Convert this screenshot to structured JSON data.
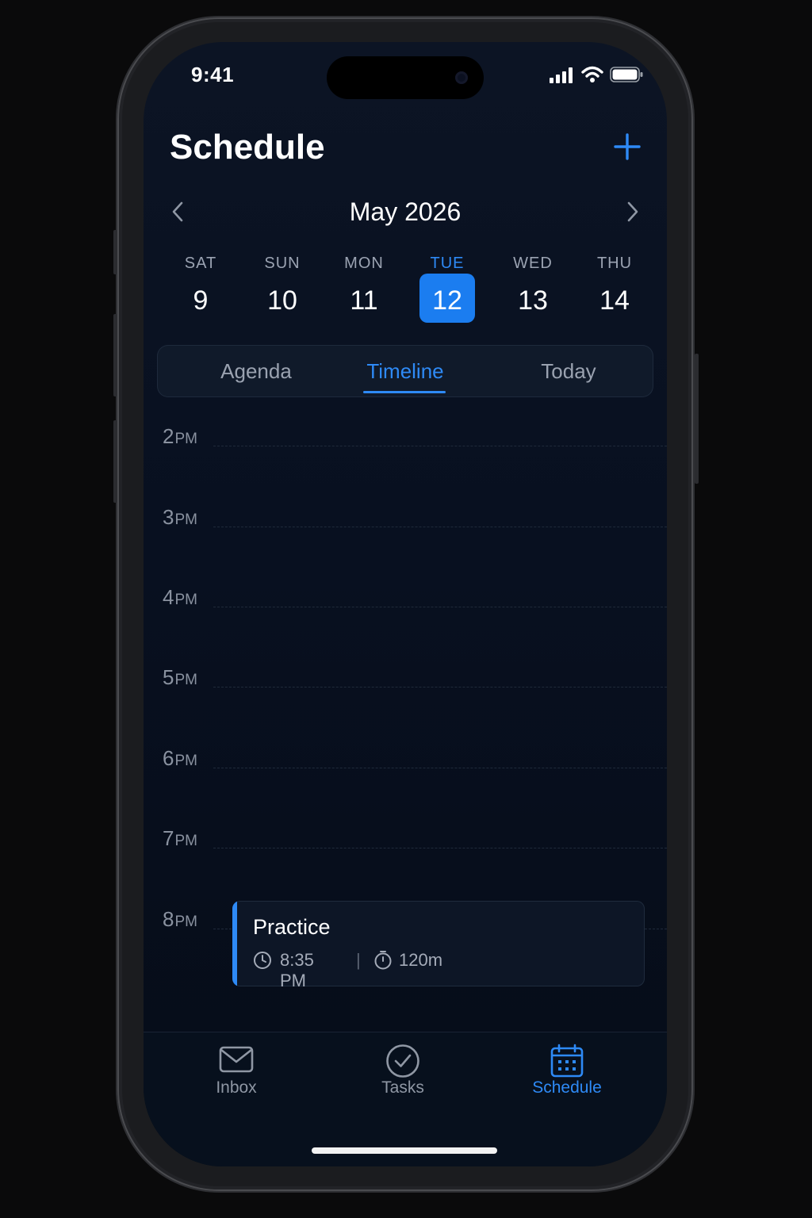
{
  "status": {
    "time": "9:41"
  },
  "header": {
    "title": "Schedule",
    "add_icon": "plus-icon"
  },
  "calendar": {
    "month": "May 2026",
    "prev_icon": "chevron-left-icon",
    "next_icon": "chevron-right-icon",
    "days": [
      {
        "dow": "SAT",
        "num": "9"
      },
      {
        "dow": "SUN",
        "num": "10"
      },
      {
        "dow": "MON",
        "num": "11"
      },
      {
        "dow": "TUE",
        "num": "12"
      },
      {
        "dow": "WED",
        "num": "13"
      },
      {
        "dow": "THU",
        "num": "14"
      }
    ],
    "selected_index": 3
  },
  "segments": {
    "items": [
      "Agenda",
      "Timeline",
      "Today"
    ],
    "active": "Timeline"
  },
  "timeline": {
    "hours": [
      {
        "n": "2",
        "ap": "PM"
      },
      {
        "n": "3",
        "ap": "PM"
      },
      {
        "n": "4",
        "ap": "PM"
      },
      {
        "n": "5",
        "ap": "PM"
      },
      {
        "n": "6",
        "ap": "PM"
      },
      {
        "n": "7",
        "ap": "PM"
      },
      {
        "n": "8",
        "ap": "PM"
      }
    ],
    "event": {
      "title": "Practice",
      "time": "8:35 PM",
      "separator": "|",
      "duration": "120m",
      "accent": "#2e8af6"
    }
  },
  "tabbar": {
    "items": [
      {
        "label": "Inbox",
        "icon": "envelope-icon"
      },
      {
        "label": "Tasks",
        "icon": "checkmark-circle-icon"
      },
      {
        "label": "Schedule",
        "icon": "calendar-icon"
      }
    ],
    "active": "Schedule"
  },
  "colors": {
    "accent": "#2e8af6",
    "background": "#081020"
  }
}
